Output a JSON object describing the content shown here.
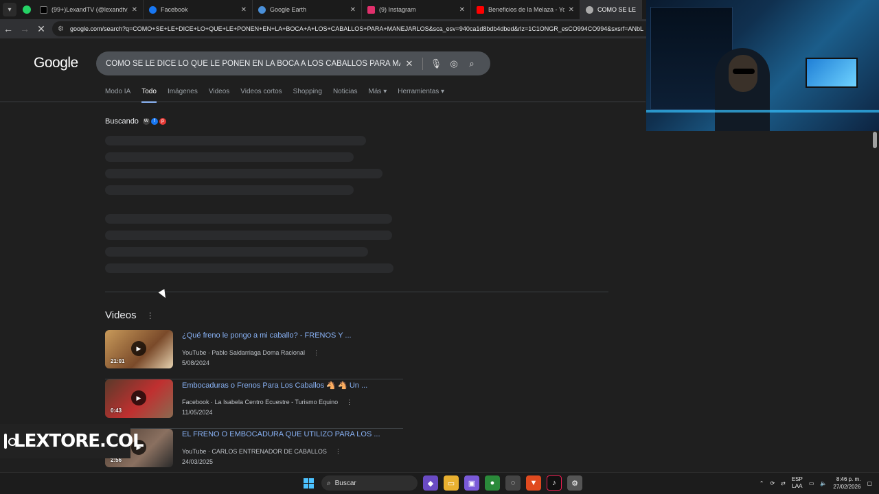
{
  "browser": {
    "tabs": [
      {
        "title": "(99+)LexandTV (@lexandtv) | Ti",
        "color": "#000000"
      },
      {
        "title": "Facebook",
        "color": "#1877f2"
      },
      {
        "title": "Google Earth",
        "color": "#4a90d9"
      },
      {
        "title": "(9) Instagram",
        "color": "#e1306c"
      },
      {
        "title": "Beneficios de la Melaza - YouTu",
        "color": "#ff0000"
      },
      {
        "title": "COMO SE LE DICE L",
        "color": "#aaaaaa"
      }
    ],
    "url": "google.com/search?q=COMO+SE+LE+DICE+LO+QUE+LE+PONEN+EN+LA+BOCA+A+LOS+CABALLOS+PARA+MANEJARLOS&sca_esv=940ca1d8bdb4dbed&rlz=1C1ONGR_esCO994CO994&sxsrf=ANbL"
  },
  "google": {
    "logo": "Google",
    "query": "COMO SE LE DICE LO QUE LE PONEN EN LA BOCA A LOS CABALLOS PARA MANEJAR",
    "filters": [
      "Modo IA",
      "Todo",
      "Imágenes",
      "Videos",
      "Videos cortos",
      "Shopping",
      "Noticias",
      "Más",
      "Herramientas"
    ],
    "loading_label": "Buscando",
    "videos_heading": "Videos",
    "videos": [
      {
        "title": "¿Qué freno le pongo a mi caballo? - FRENOS Y ...",
        "source": "YouTube · Pablo Saldarriaga Doma Racional",
        "date": "5/08/2024",
        "duration": "21:01"
      },
      {
        "title": "Embocaduras o Frenos Para Los Caballos 🐴 🐴 Un ...",
        "source": "Facebook · La Isabela Centro Ecuestre - Turismo Equino",
        "date": "11/05/2024",
        "duration": "0:43"
      },
      {
        "title": "EL FRENO O EMBOCADURA QUE UTILIZO PARA LOS ...",
        "source": "YouTube · CARLOS ENTRENADOR DE CABALLOS",
        "date": "24/03/2025",
        "duration": "2:56"
      }
    ]
  },
  "overlay": {
    "handle": "LEXTORE.COL"
  },
  "taskbar": {
    "search_label": "Buscar",
    "lang_top": "ESP",
    "lang_bottom": "LAA",
    "time": "8:46 p. m.",
    "date": "27/02/2026"
  }
}
